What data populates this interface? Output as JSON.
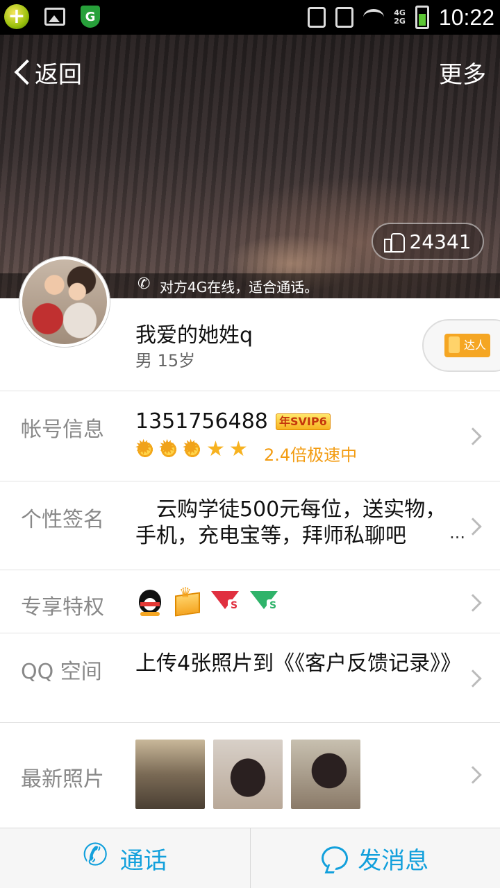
{
  "status_bar": {
    "time": "10:22",
    "network_top": "4G",
    "network_bottom": "2G"
  },
  "header": {
    "back_label": "返回",
    "more_label": "更多",
    "like_count": "24341",
    "call_hint": "对方4G在线，适合通话。"
  },
  "profile": {
    "name": "我爱的她姓q",
    "gender_age": "男 15岁",
    "expert_badge": "达人"
  },
  "rows": {
    "account": {
      "label": "帐号信息",
      "number": "1351756488",
      "vip_badge": "年SVIP6",
      "speed_text": "2.4倍极速中",
      "suns": 3,
      "stars": 2
    },
    "signature": {
      "label": "个性签名",
      "text": "　云购学徒500元每位，送实物，手机，充电宝等，拜师私聊吧",
      "ellipsis": "..."
    },
    "privileges": {
      "label": "专享特权",
      "icons": [
        "qq-penguin-icon",
        "vip-crown-icon",
        "red-diamond-icon",
        "green-diamond-icon"
      ]
    },
    "qzone": {
      "label": "QQ 空间",
      "text": "上传4张照片到《《客户反馈记录》》"
    },
    "photos": {
      "label": "最新照片",
      "count": 3
    }
  },
  "bottom_bar": {
    "call_label": "通话",
    "message_label": "发消息"
  },
  "colors": {
    "accent_blue": "#12a0dc",
    "speed_orange": "#f39c12",
    "label_gray": "#888888"
  }
}
